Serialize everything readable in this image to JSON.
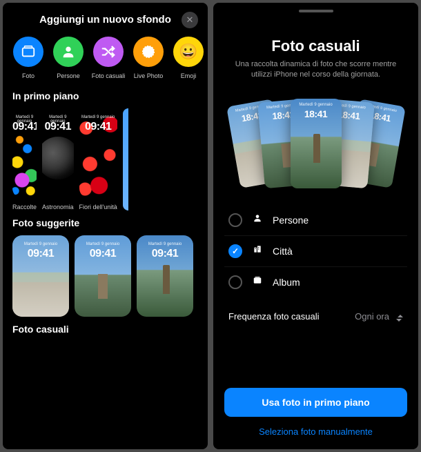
{
  "left": {
    "sheet_title": "Aggiungi un nuovo sfondo",
    "close": "✕",
    "categories": [
      {
        "label": "Foto"
      },
      {
        "label": "Persone"
      },
      {
        "label": "Foto casuali"
      },
      {
        "label": "Live Photo"
      },
      {
        "label": "Emoji"
      }
    ],
    "featured": {
      "title": "In primo piano",
      "sample_date": "Martedì 9 gennaio",
      "sample_time": "09:41",
      "items": [
        {
          "label": "Raccolte"
        },
        {
          "label": "Astronomia"
        },
        {
          "label": "Fiori dell'unità"
        }
      ]
    },
    "suggested": {
      "title": "Foto suggerite",
      "sample_date": "Martedì 9 gennaio",
      "sample_time": "09:41"
    },
    "random": {
      "title": "Foto casuali"
    }
  },
  "right": {
    "title": "Foto casuali",
    "subtitle": "Una raccolta dinamica di foto che scorre mentre utilizzi iPhone nel corso della giornata.",
    "fan_date": "Martedì 9 gennaio",
    "fan_time": "18:41",
    "options": [
      {
        "label": "Persone",
        "checked": false
      },
      {
        "label": "Città",
        "checked": true
      },
      {
        "label": "Album",
        "checked": false
      }
    ],
    "frequency": {
      "label": "Frequenza foto casuali",
      "value": "Ogni ora"
    },
    "primary_btn": "Usa foto in primo piano",
    "link_btn": "Seleziona foto manualmente"
  }
}
